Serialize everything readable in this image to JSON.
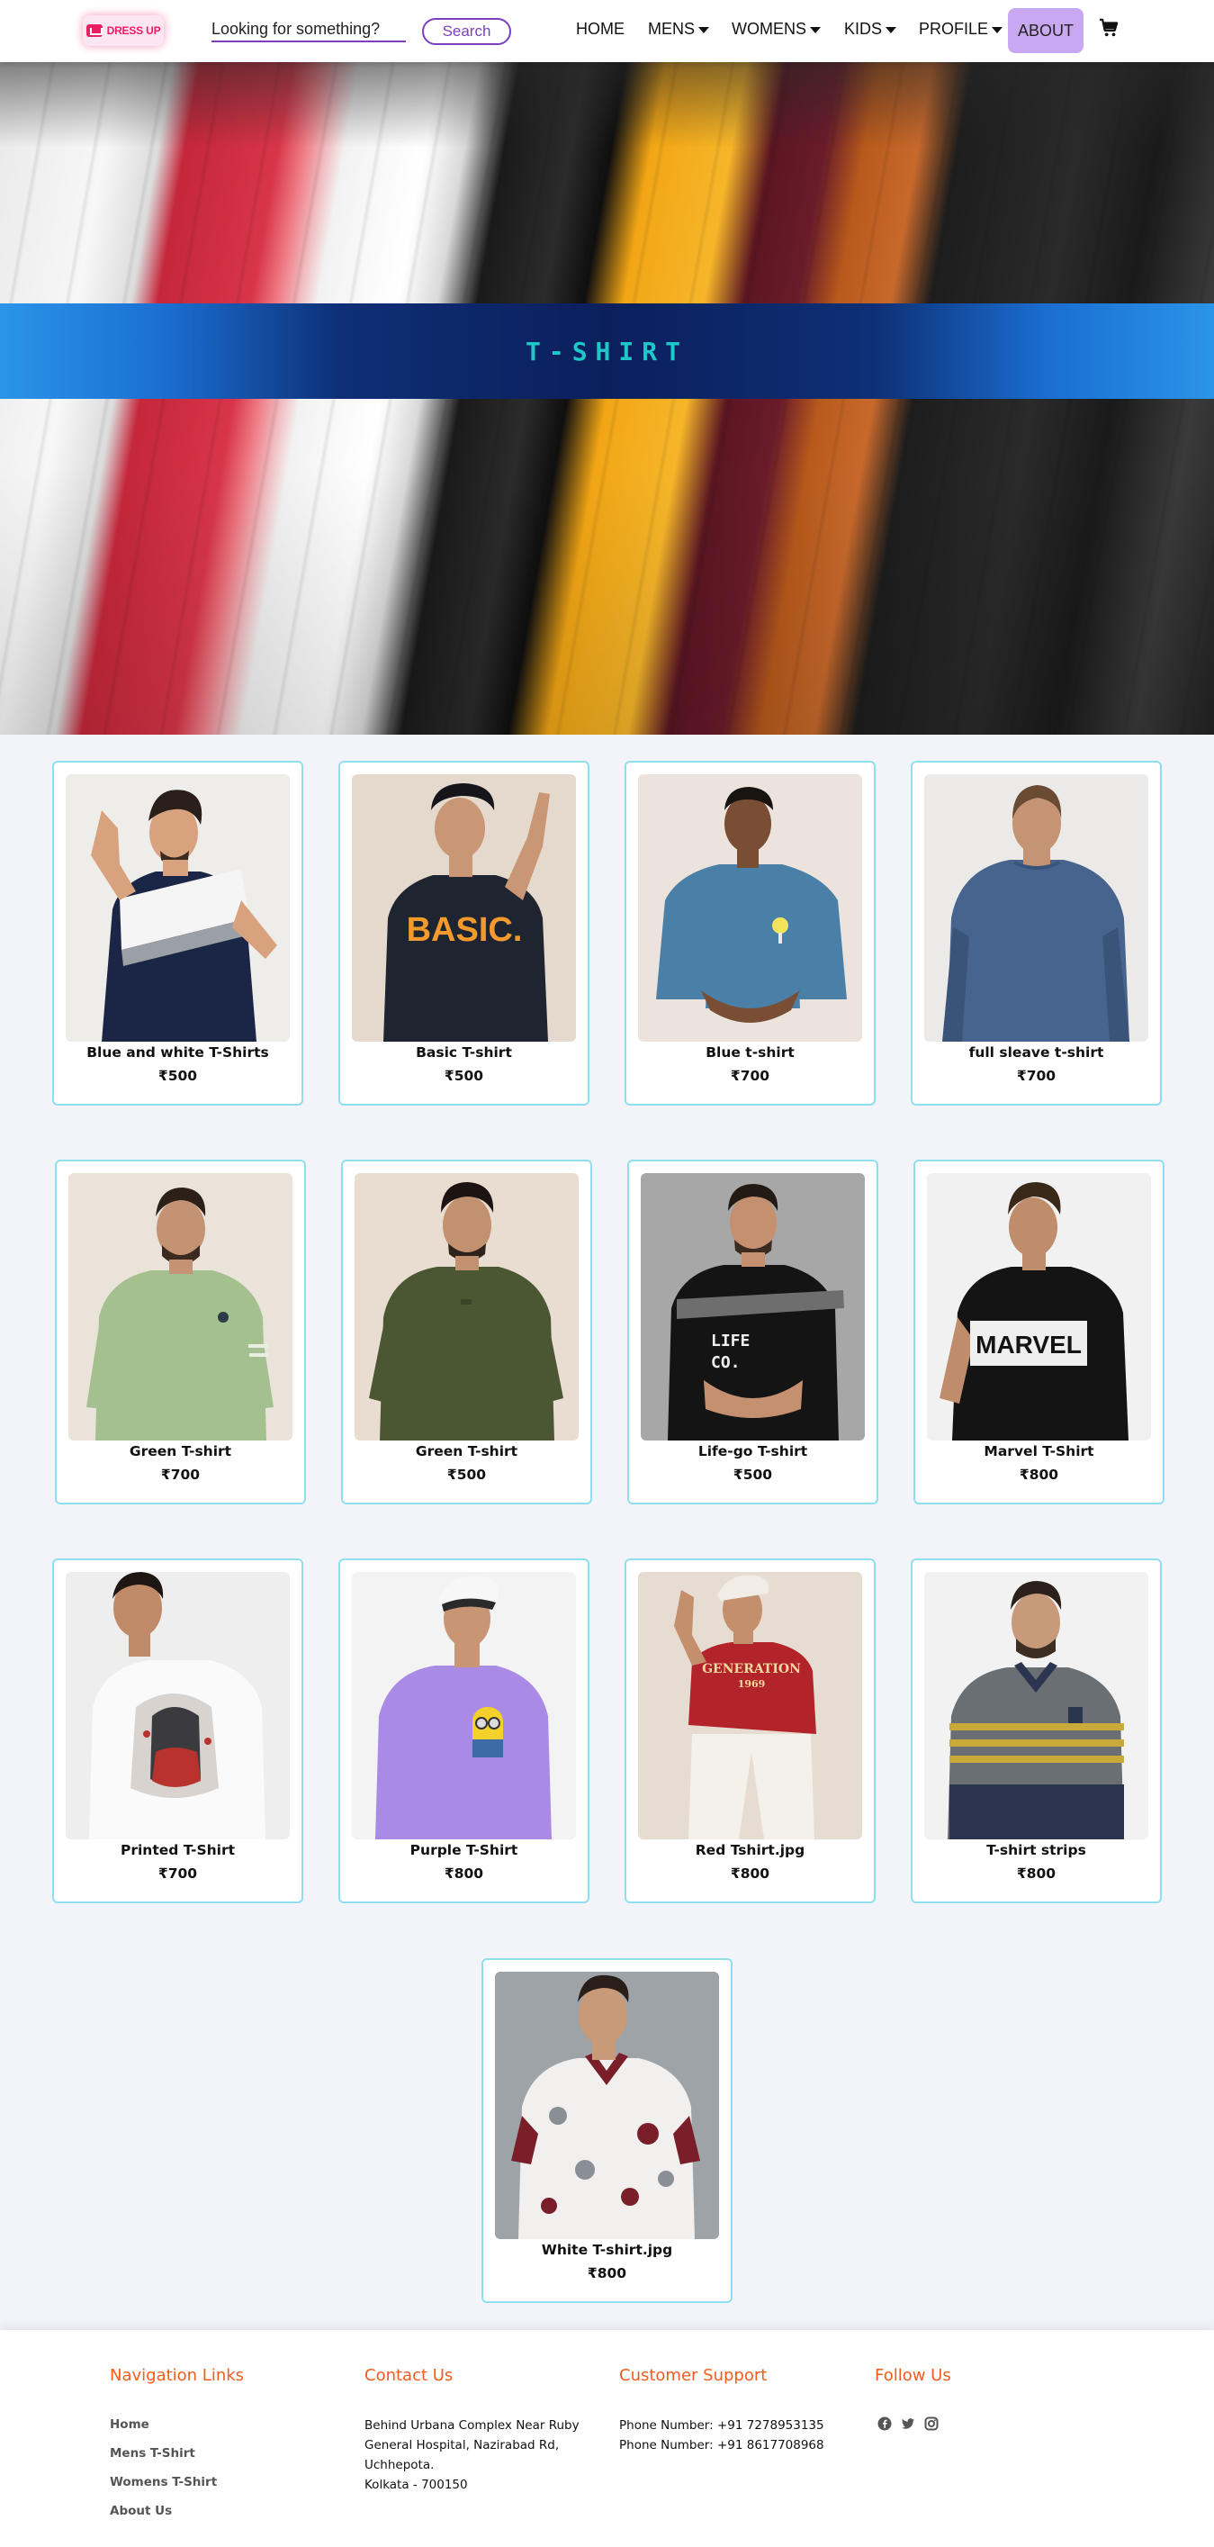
{
  "brand": {
    "logo_text": "DRESS UP"
  },
  "search": {
    "placeholder": "Looking for something?",
    "button_label": "Search"
  },
  "nav": {
    "home": "HOME",
    "mens": "MENS",
    "womens": "WOMENS",
    "kids": "KIDS",
    "profile": "PROFILE",
    "about": "ABOUT"
  },
  "hero": {
    "title": "T-SHIRT"
  },
  "products": [
    {
      "name": "Blue and white T-Shirts",
      "price": "₹500",
      "image": "man-in-navy-white-colorblock-tshirt"
    },
    {
      "name": "Basic T-shirt",
      "price": "₹500",
      "image": "man-in-black-basic-print-tshirt"
    },
    {
      "name": "Blue t-shirt",
      "price": "₹700",
      "image": "man-in-blue-tshirt"
    },
    {
      "name": "full sleave t-shirt",
      "price": "₹700",
      "image": "man-back-in-blue-full-sleeve"
    },
    {
      "name": "Green T-shirt",
      "price": "₹700",
      "image": "man-in-sage-green-tshirt"
    },
    {
      "name": "Green T-shirt",
      "price": "₹500",
      "image": "man-in-olive-green-tshirt"
    },
    {
      "name": "Life-go T-shirt",
      "price": "₹500",
      "image": "man-in-black-life-co-tshirt"
    },
    {
      "name": "Marvel T-Shirt",
      "price": "₹800",
      "image": "man-in-black-marvel-tshirt"
    },
    {
      "name": "Printed T-Shirt",
      "price": "₹700",
      "image": "man-in-white-printed-tshirt"
    },
    {
      "name": "Purple T-Shirt",
      "price": "₹800",
      "image": "man-in-purple-minion-tshirt"
    },
    {
      "name": "Red Tshirt.jpg",
      "price": "₹800",
      "image": "man-in-red-generation-tshirt"
    },
    {
      "name": "T-shirt strips",
      "price": "₹800",
      "image": "man-in-striped-polo"
    },
    {
      "name": "White T-shirt.jpg",
      "price": "₹800",
      "image": "man-in-floral-white-polo"
    }
  ],
  "print_texts": {
    "basic": "BASIC.",
    "life": "LIFE",
    "co": "CO.",
    "marvel": "MARVEL",
    "generation": "GENERATION",
    "year": "1969"
  },
  "footer": {
    "nav_heading": "Navigation Links",
    "nav_links": [
      "Home",
      "Mens T-Shirt",
      "Womens T-Shirt",
      "About Us"
    ],
    "contact_heading": "Contact Us",
    "address_lines": [
      "Behind Urbana Complex Near Ruby",
      "General Hospital, Nazirabad Rd,",
      "Uchhepota.",
      "Kolkata - 700150"
    ],
    "support_heading": "Customer Support",
    "phones": [
      "Phone Number: +91 7278953135",
      "Phone Number: +91 8617708968"
    ],
    "follow_heading": "Follow Us",
    "social_icons": [
      "facebook-icon",
      "twitter-icon",
      "instagram-icon"
    ]
  },
  "colors": {
    "accent_purple": "#7b3fbf",
    "about_bg": "#c9a8f2",
    "brand_pink": "#e91e63",
    "footer_heading": "#f25c1c",
    "card_border": "#8fdff0",
    "hero_title": "#1fc8c8"
  }
}
